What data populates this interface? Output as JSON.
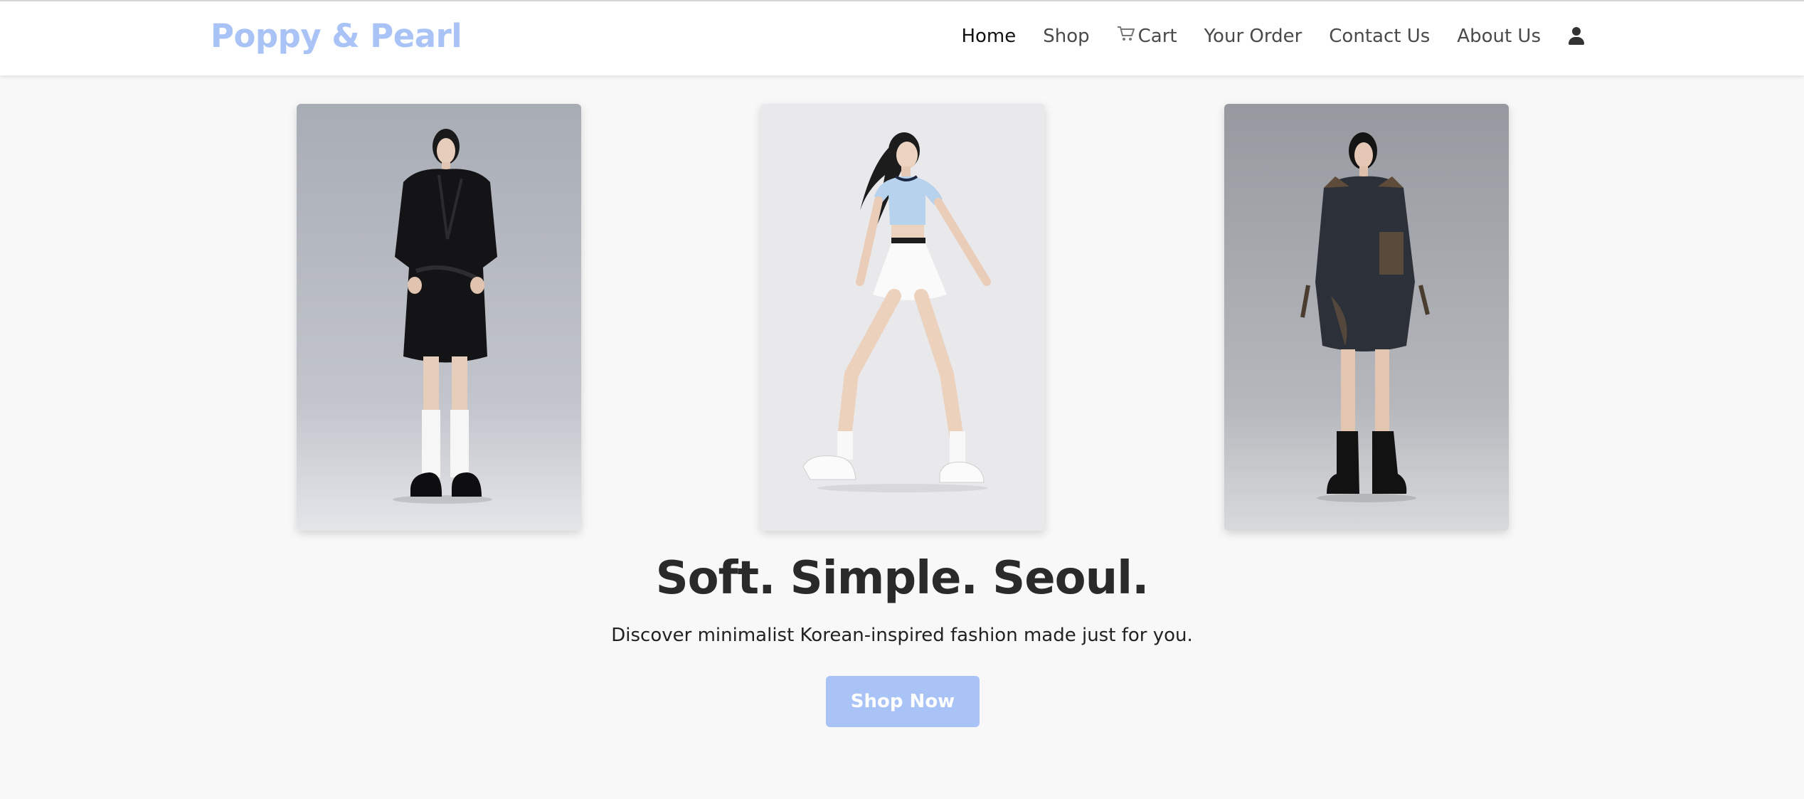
{
  "brand": {
    "name": "Poppy & Pearl",
    "color": "#a9c3f6"
  },
  "nav": {
    "items": [
      {
        "label": "Home",
        "active": true
      },
      {
        "label": "Shop"
      },
      {
        "label": "Cart",
        "icon": "cart-icon"
      },
      {
        "label": "Your Order"
      },
      {
        "label": "Contact Us"
      },
      {
        "label": "About Us"
      }
    ],
    "user_icon": "user-icon"
  },
  "gallery": [
    {
      "subject": "model-black-leather-coat"
    },
    {
      "subject": "model-blue-top-white-skirt"
    },
    {
      "subject": "model-dark-patchwork-blazer"
    }
  ],
  "hero": {
    "headline": "Soft. Simple. Seoul.",
    "subtitle": "Discover minimalist Korean-inspired fashion made just for you.",
    "cta_label": "Shop Now"
  },
  "colors": {
    "accent": "#a9c3f6",
    "background": "#f8f8f8"
  }
}
